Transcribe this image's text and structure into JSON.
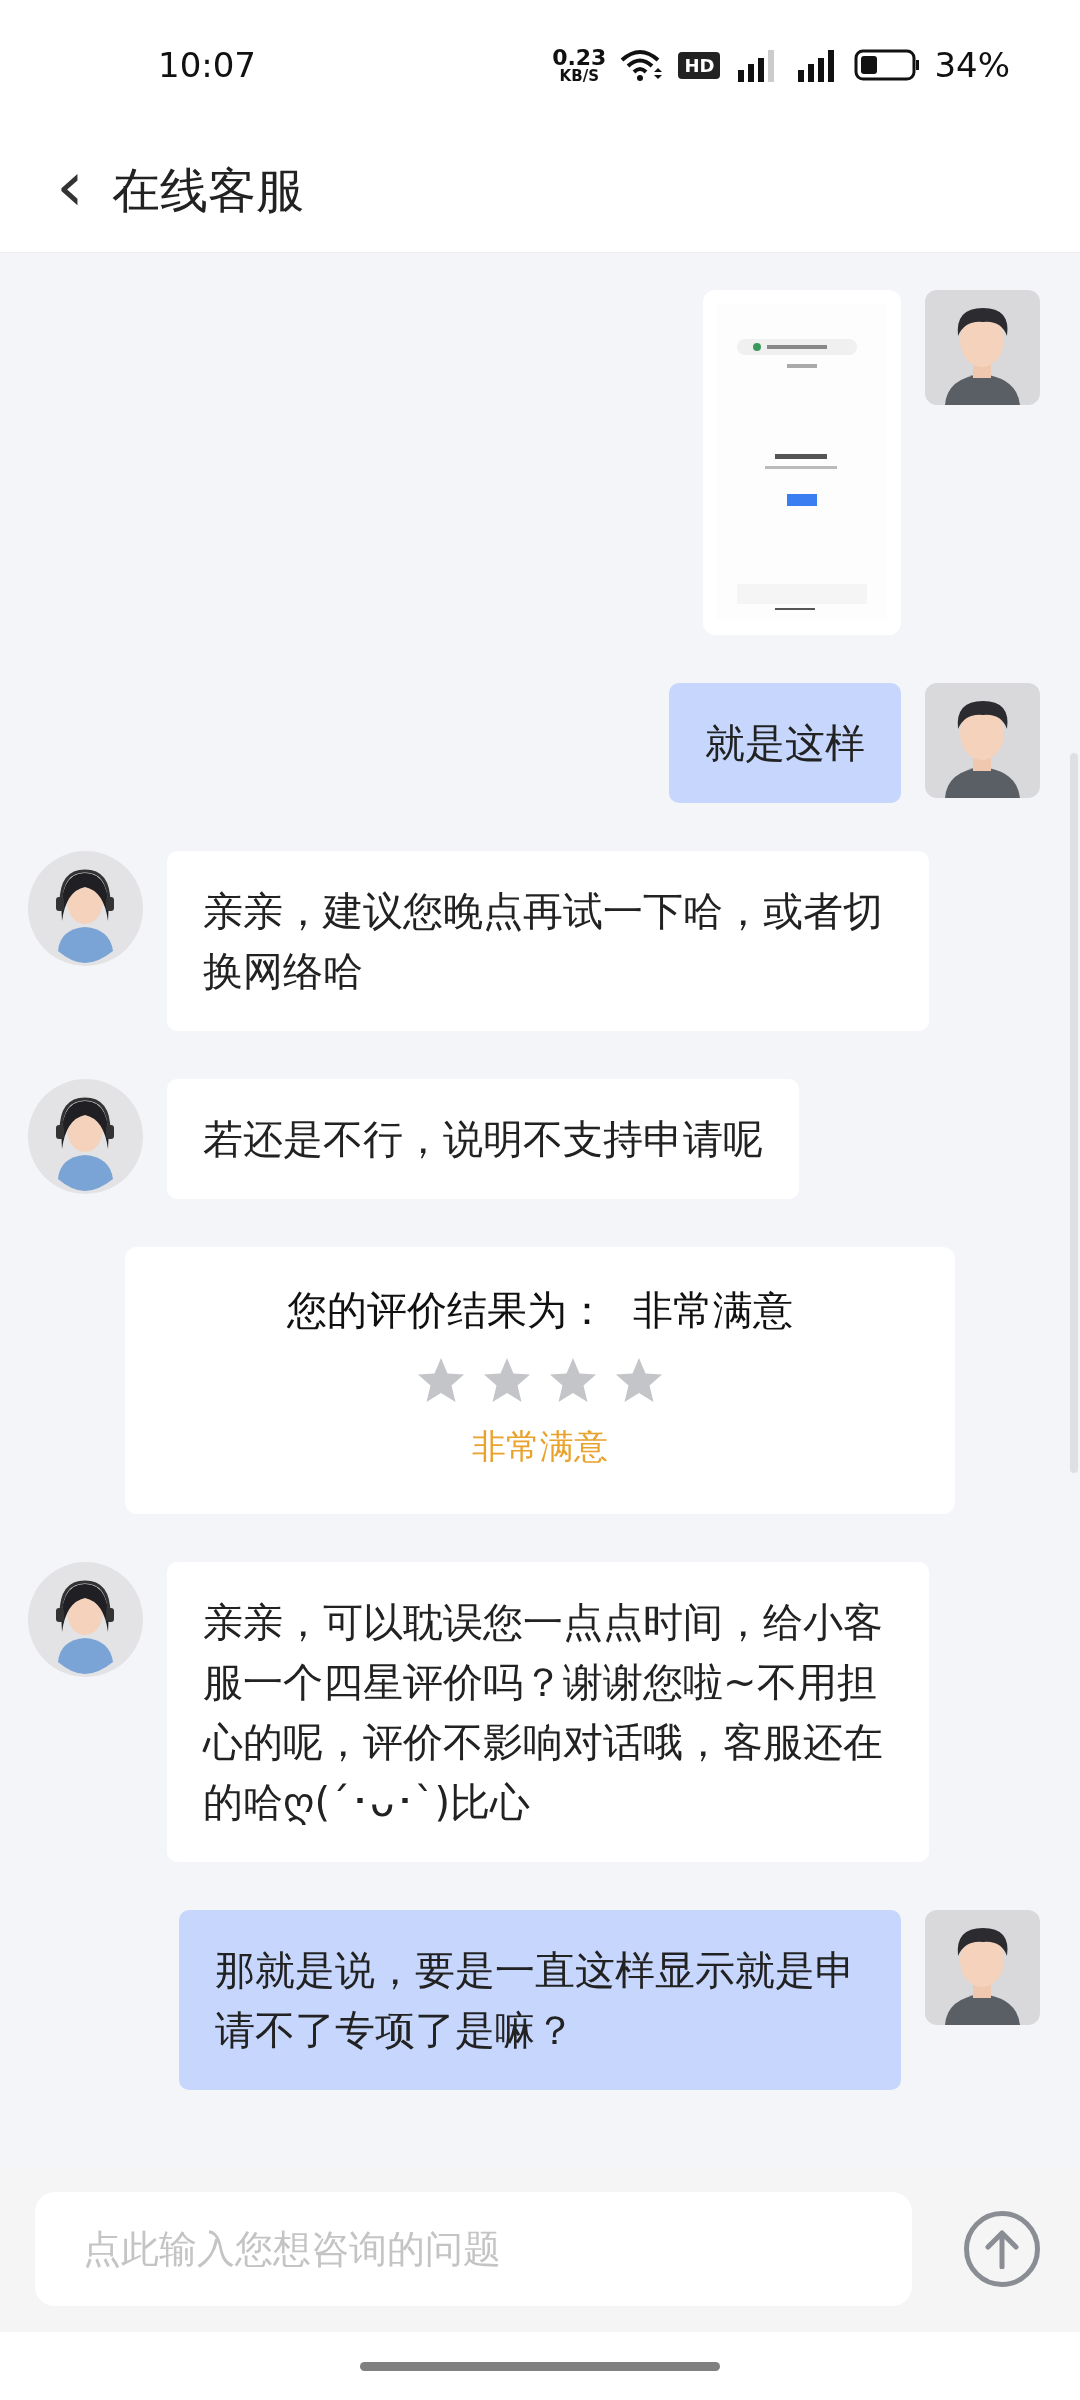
{
  "status_bar": {
    "time": "10:07",
    "speed_value": "0.23",
    "speed_unit": "KB/S",
    "hd": "HD",
    "battery": "34%"
  },
  "header": {
    "back": "‹",
    "title": "在线客服"
  },
  "messages": [
    {
      "kind": "user_image"
    },
    {
      "kind": "user_text",
      "text": "就是这样"
    },
    {
      "kind": "agent_text",
      "text": "亲亲，建议您晚点再试一下哈，或者切换网络哈"
    },
    {
      "kind": "agent_text",
      "text": "若还是不行，说明不支持申请呢"
    },
    {
      "kind": "rating",
      "label": "您的评价结果为：",
      "result": "非常满意",
      "stars": 0,
      "caption": "非常满意"
    },
    {
      "kind": "agent_text",
      "text": "亲亲，可以耽误您一点点时间，给小客服一个四星评价吗？谢谢您啦~不用担心的呢，评价不影响对话哦，客服还在的哈ღ(´･ᴗ･`)比心"
    },
    {
      "kind": "user_text",
      "text": "那就是说，要是一直这样显示就是申请不了专项了是嘛？"
    }
  ],
  "input": {
    "placeholder": "点此输入您想咨询的问题"
  }
}
